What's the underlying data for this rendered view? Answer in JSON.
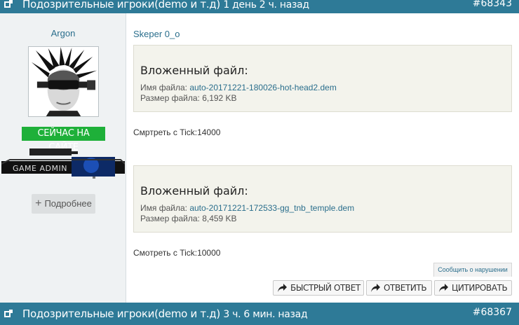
{
  "posts": [
    {
      "header": {
        "title": "Подозрительные игроки(demo и т.д)",
        "time": "1 день 2 ч. назад",
        "number": "#68343"
      },
      "author": {
        "name": "Argon",
        "online_label": "СЕЙЧАС НА САЙТЕ",
        "rank_label": "GAME ADMIN",
        "more_label": "Подробнее"
      },
      "reply_to": "Skeper 0_o",
      "attachments": [
        {
          "heading": "Вложенный файл:",
          "name_label": "Имя файла:",
          "file_name": "auto-20171221-180026-hot-head2.dem",
          "size_label": "Размер файла:",
          "file_size": "6,192 KB"
        },
        {
          "heading": "Вложенный файл:",
          "name_label": "Имя файла:",
          "file_name": "auto-20171221-172533-gg_tnb_temple.dem",
          "size_label": "Размер файла:",
          "file_size": "8,459 KB"
        }
      ],
      "notes": [
        "Смртреть с Tick:14000",
        "Смотреть с Tick:10000"
      ],
      "report_label": "Сообщить о нарушении",
      "actions": {
        "fast_reply": "БЫСТРЫЙ ОТВЕТ",
        "reply": "ОТВЕТИТЬ",
        "quote": "ЦИТИРОВАТЬ"
      }
    },
    {
      "header": {
        "title": "Подозрительные игроки(demo и т.д)",
        "time": "3 ч. 6 мин. назад",
        "number": "#68367"
      }
    }
  ],
  "icons": {
    "post-bullet": "post-bullet-icon",
    "action-arrow": "share-arrow-icon",
    "plus": "plus-icon"
  },
  "colors": {
    "header_bg": "#2e7a97",
    "online_badge": "#1eb039",
    "link": "#2a6e8c",
    "sidebar_bg": "#eff2f3",
    "attachment_bg": "#f3f3ec"
  }
}
